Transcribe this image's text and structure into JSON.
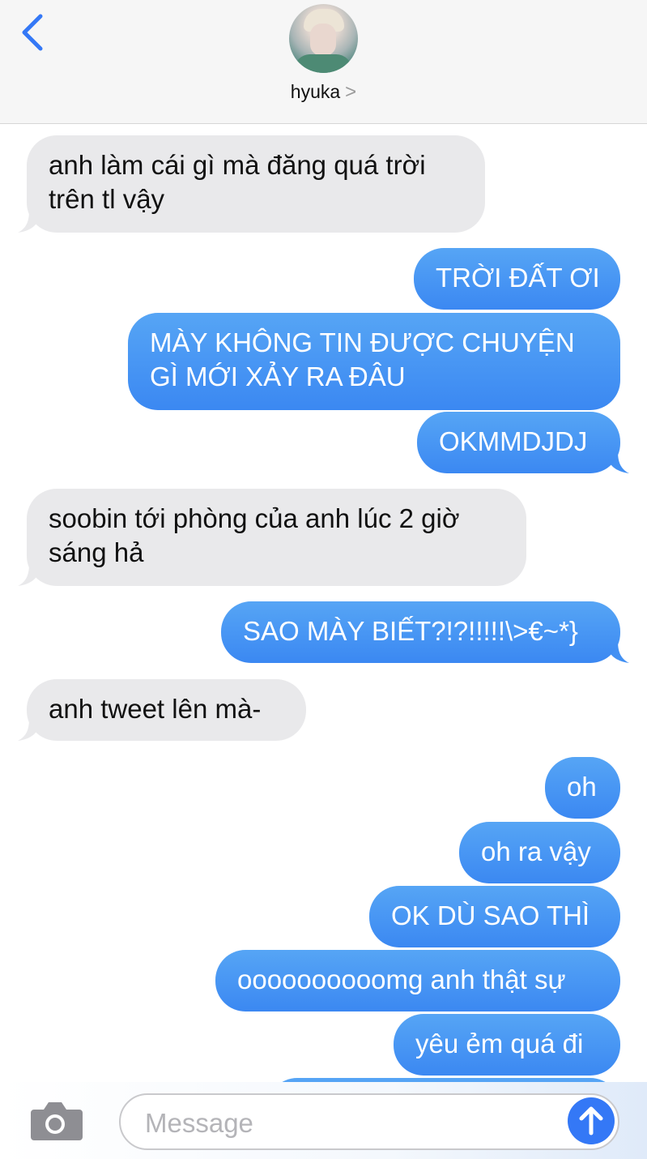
{
  "header": {
    "contact_name": "hyuka",
    "chevron": ">"
  },
  "messages": [
    {
      "side": "received",
      "lines": [
        "anh làm cái gì mà đăng quá trời",
        "trên tl vậy"
      ]
    },
    {
      "side": "sent",
      "lines": [
        "TRỜI ĐẤT ƠI"
      ]
    },
    {
      "side": "sent",
      "lines": [
        "MÀY KHÔNG TIN ĐƯỢC CHUYỆN",
        "GÌ MỚI XẢY RA ĐÂU"
      ]
    },
    {
      "side": "sent",
      "lines": [
        "OKMMDJDJ"
      ]
    },
    {
      "side": "received",
      "lines": [
        "soobin tới phòng của anh lúc 2 giờ",
        "sáng hả"
      ]
    },
    {
      "side": "sent",
      "lines": [
        "SAO MÀY BIẾT?!?!!!!!\\>€~*}"
      ]
    },
    {
      "side": "received",
      "lines": [
        "anh tweet lên mà-"
      ]
    },
    {
      "side": "sent",
      "lines": [
        "oh"
      ]
    },
    {
      "side": "sent",
      "lines": [
        "oh ra vậy"
      ]
    },
    {
      "side": "sent",
      "lines": [
        "OK DÙ SAO THÌ"
      ]
    },
    {
      "side": "sent",
      "lines": [
        "oooooooooomg anh thật sự"
      ]
    },
    {
      "side": "sent",
      "lines": [
        "yêu ẻm quá đi"
      ]
    }
  ],
  "input": {
    "placeholder": "Message"
  },
  "icons": {
    "back": "chevron-left-icon",
    "camera": "camera-icon",
    "send": "arrow-up-icon"
  },
  "colors": {
    "accent": "#3478f6",
    "sent_bubble": "#4a98f4",
    "received_bubble": "#e9e9eb"
  }
}
